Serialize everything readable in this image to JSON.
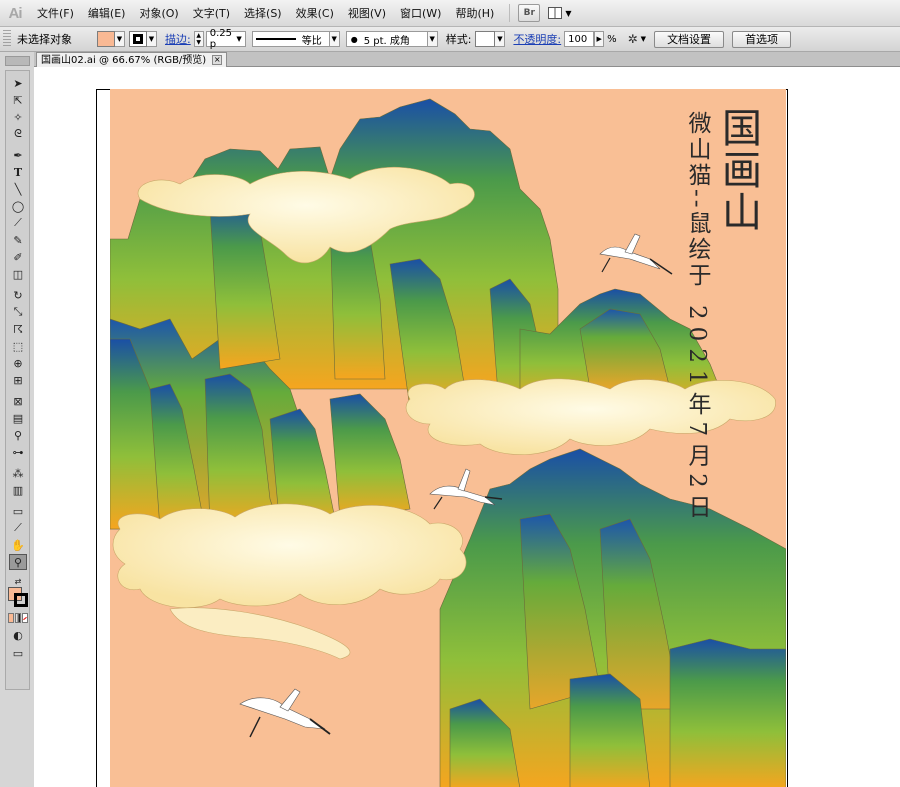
{
  "app": {
    "logo": "Ai"
  },
  "menu": {
    "items": [
      {
        "id": "file",
        "label": "文件(F)"
      },
      {
        "id": "edit",
        "label": "编辑(E)"
      },
      {
        "id": "object",
        "label": "对象(O)"
      },
      {
        "id": "type",
        "label": "文字(T)"
      },
      {
        "id": "select",
        "label": "选择(S)"
      },
      {
        "id": "effect",
        "label": "效果(C)"
      },
      {
        "id": "view",
        "label": "视图(V)"
      },
      {
        "id": "window",
        "label": "窗口(W)"
      },
      {
        "id": "help",
        "label": "帮助(H)"
      }
    ],
    "bridge_label": "Br"
  },
  "control": {
    "selection_label": "未选择对象",
    "fill_color": "#f9b994",
    "stroke_color": "#000000",
    "stroke_label": "描边:",
    "stroke_weight": "0.25 p",
    "stroke_profile_label": "等比",
    "brush_label": "5 pt. 成角",
    "style_label": "样式:",
    "opacity_label": "不透明度:",
    "opacity_value": "100",
    "opacity_unit": "%",
    "doc_setup_button": "文档设置",
    "preferences_button": "首选项"
  },
  "document": {
    "tab_title": "国画山02.ai @ 66.67% (RGB/预览)",
    "close_glyph": "×"
  },
  "tools": [
    "selection-tool",
    "direct-selection-tool",
    "magic-wand-tool",
    "lasso-tool",
    "pen-tool",
    "type-tool",
    "line-tool",
    "ellipse-tool",
    "paintbrush-tool",
    "pencil-tool",
    "blob-brush-tool",
    "eraser-tool",
    "rotate-tool",
    "scale-tool",
    "warp-tool",
    "free-transform-tool",
    "shape-builder-tool",
    "perspective-grid-tool",
    "mesh-tool",
    "gradient-tool",
    "eyedropper-tool",
    "blend-tool",
    "symbol-sprayer-tool",
    "column-graph-tool",
    "artboard-tool",
    "slice-tool",
    "hand-tool",
    "zoom-tool"
  ],
  "artwork": {
    "title": "国画山",
    "author_line": "微山猫--鼠绘于",
    "date_line": "2021年7月2日",
    "background_color": "#f9bf95",
    "mountain_top_color": "#1d55a8",
    "mountain_mid_color": "#6fae3a",
    "mountain_low_color": "#f5a623",
    "cloud_color": "#fdf3c4"
  }
}
